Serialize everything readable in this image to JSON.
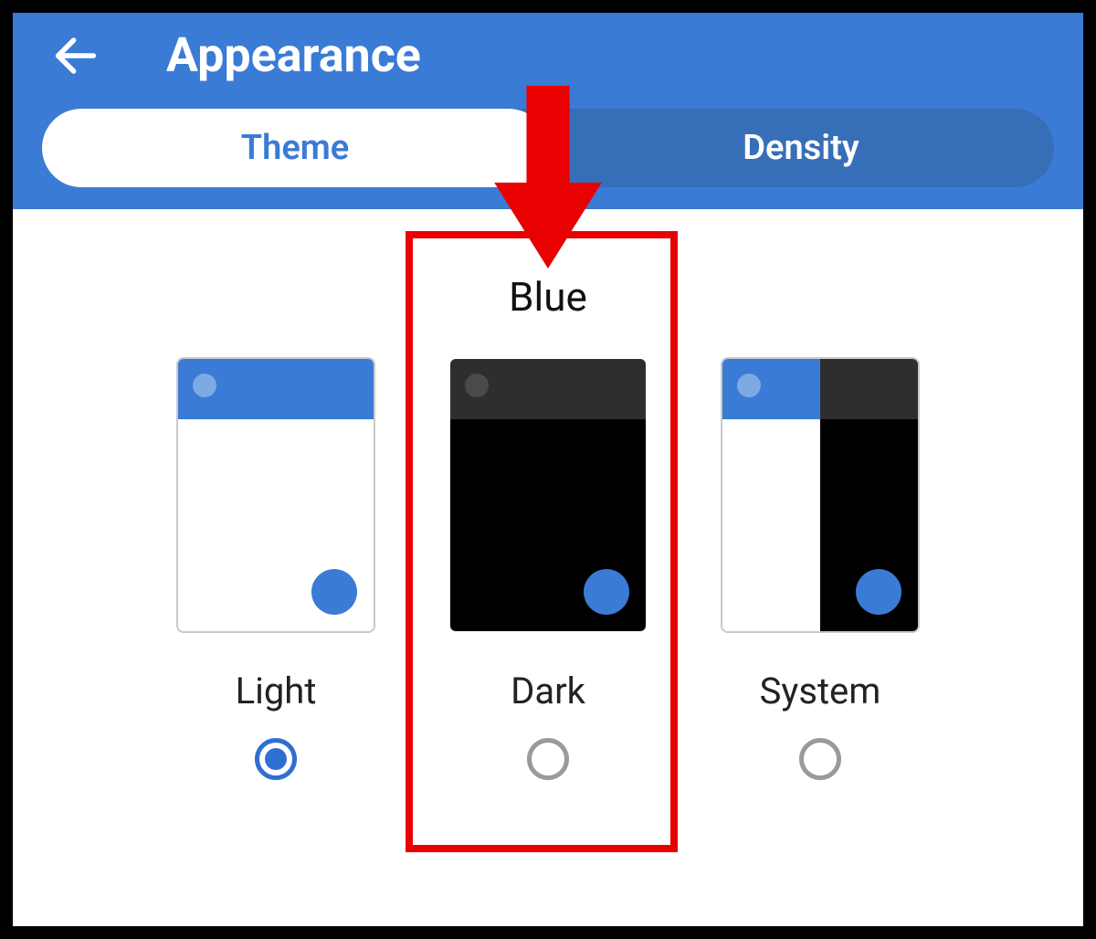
{
  "header": {
    "title": "Appearance"
  },
  "tabs": {
    "theme": "Theme",
    "density": "Density",
    "active": "theme"
  },
  "section": {
    "label": "Blue"
  },
  "options": [
    {
      "id": "light",
      "label": "Light",
      "selected": true
    },
    {
      "id": "dark",
      "label": "Dark",
      "selected": false
    },
    {
      "id": "system",
      "label": "System",
      "selected": false
    }
  ],
  "colors": {
    "primary": "#3a7bd5",
    "annotation": "#e90000"
  },
  "annotation": {
    "highlighted_option": "dark"
  }
}
